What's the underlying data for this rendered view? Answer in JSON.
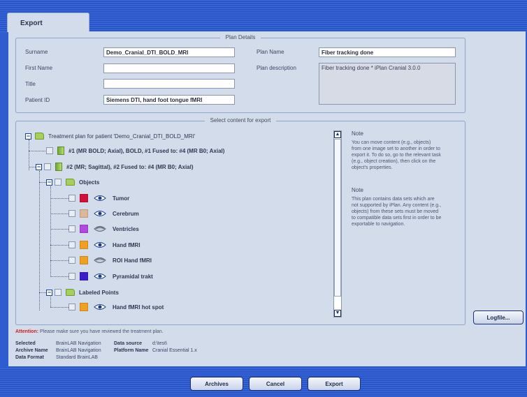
{
  "tab": {
    "label": "Export"
  },
  "plan_details": {
    "title": "Plan Details",
    "surname_label": "Surname",
    "surname_value": "Demo_Cranial_DTI_BOLD_MRI",
    "first_name_label": "First Name",
    "first_name_value": "",
    "title_label": "Title",
    "title_value": "",
    "patient_id_label": "Patient ID",
    "patient_id_value": "Siemens DTI, hand foot tongue fMRI",
    "plan_name_label": "Plan Name",
    "plan_name_value": "Fiber tracking done",
    "plan_desc_label": "Plan description",
    "plan_desc_value": "Fiber tracking done * iPlan Cranial 3.0.0"
  },
  "select_content": {
    "title": "Select content for export",
    "root": "Treatment plan for patient 'Demo_Cranial_DTI_BOLD_MRI'",
    "set1": "#1 (MR BOLD; Axial), BOLD, #1    Fused to: #4 (MR B0; Axial)",
    "set2": "#2 (MR; Sagittal), #2    Fused to: #4 (MR B0; Axial)",
    "objects_label": "Objects",
    "objects": [
      {
        "label": "Tumor",
        "color": "#d0103a",
        "eye": "visible"
      },
      {
        "label": "Cerebrum",
        "color": "#dcb89a",
        "eye": "visible"
      },
      {
        "label": "Ventricles",
        "color": "#b048e0",
        "eye": "hidden"
      },
      {
        "label": "Hand fMRI",
        "color": "#f0a020",
        "eye": "visible"
      },
      {
        "label": "ROI Hand fMRI",
        "color": "#f0a020",
        "eye": "hidden"
      },
      {
        "label": "Pyramidal trakt",
        "color": "#3a1ecc",
        "eye": "visible"
      }
    ],
    "labeled_points_label": "Labeled Points",
    "labeled_points": [
      {
        "label": "Hand fMRI hot spot",
        "color": "#f0a020",
        "eye": "visible"
      }
    ]
  },
  "notes": {
    "note1_title": "Note",
    "note1_lines": [
      "You can move content (e.g., objects)",
      "from one image set to another in order to",
      "export it. To do so, go to the relevant task",
      "(e.g., object creation), then click on the",
      "object's properties."
    ],
    "note2_title": "Note",
    "note2_lines": [
      "This plan contains data sets which are",
      "not supported by iPlan. Any content (e.g.,",
      "objects) from these sets must be moved",
      "to compatible data sets first in order to be",
      "exportable to navigation."
    ]
  },
  "attention": {
    "label": "Attention:",
    "text": " Please make sure you have reviewed the treatment plan."
  },
  "meta": {
    "selected_label": "Selected",
    "selected_value": "BrainLAB Navigation",
    "archive_label": "Archive Name",
    "archive_value": "BrainLAB Navigation",
    "format_label": "Data Format",
    "format_value": "Standard BrainLAB",
    "source_label": "Data source",
    "source_value": "d:\\test\\",
    "platform_label": "Platform Name",
    "platform_value": "Cranial Essential 1.x"
  },
  "buttons": {
    "logfile": "Logfile...",
    "archives": "Archives",
    "cancel": "Cancel",
    "export": "Export"
  },
  "colors": {
    "background_blue": "#2f5ccf",
    "panel": "#d2dceb",
    "attention_red": "#d12020"
  }
}
